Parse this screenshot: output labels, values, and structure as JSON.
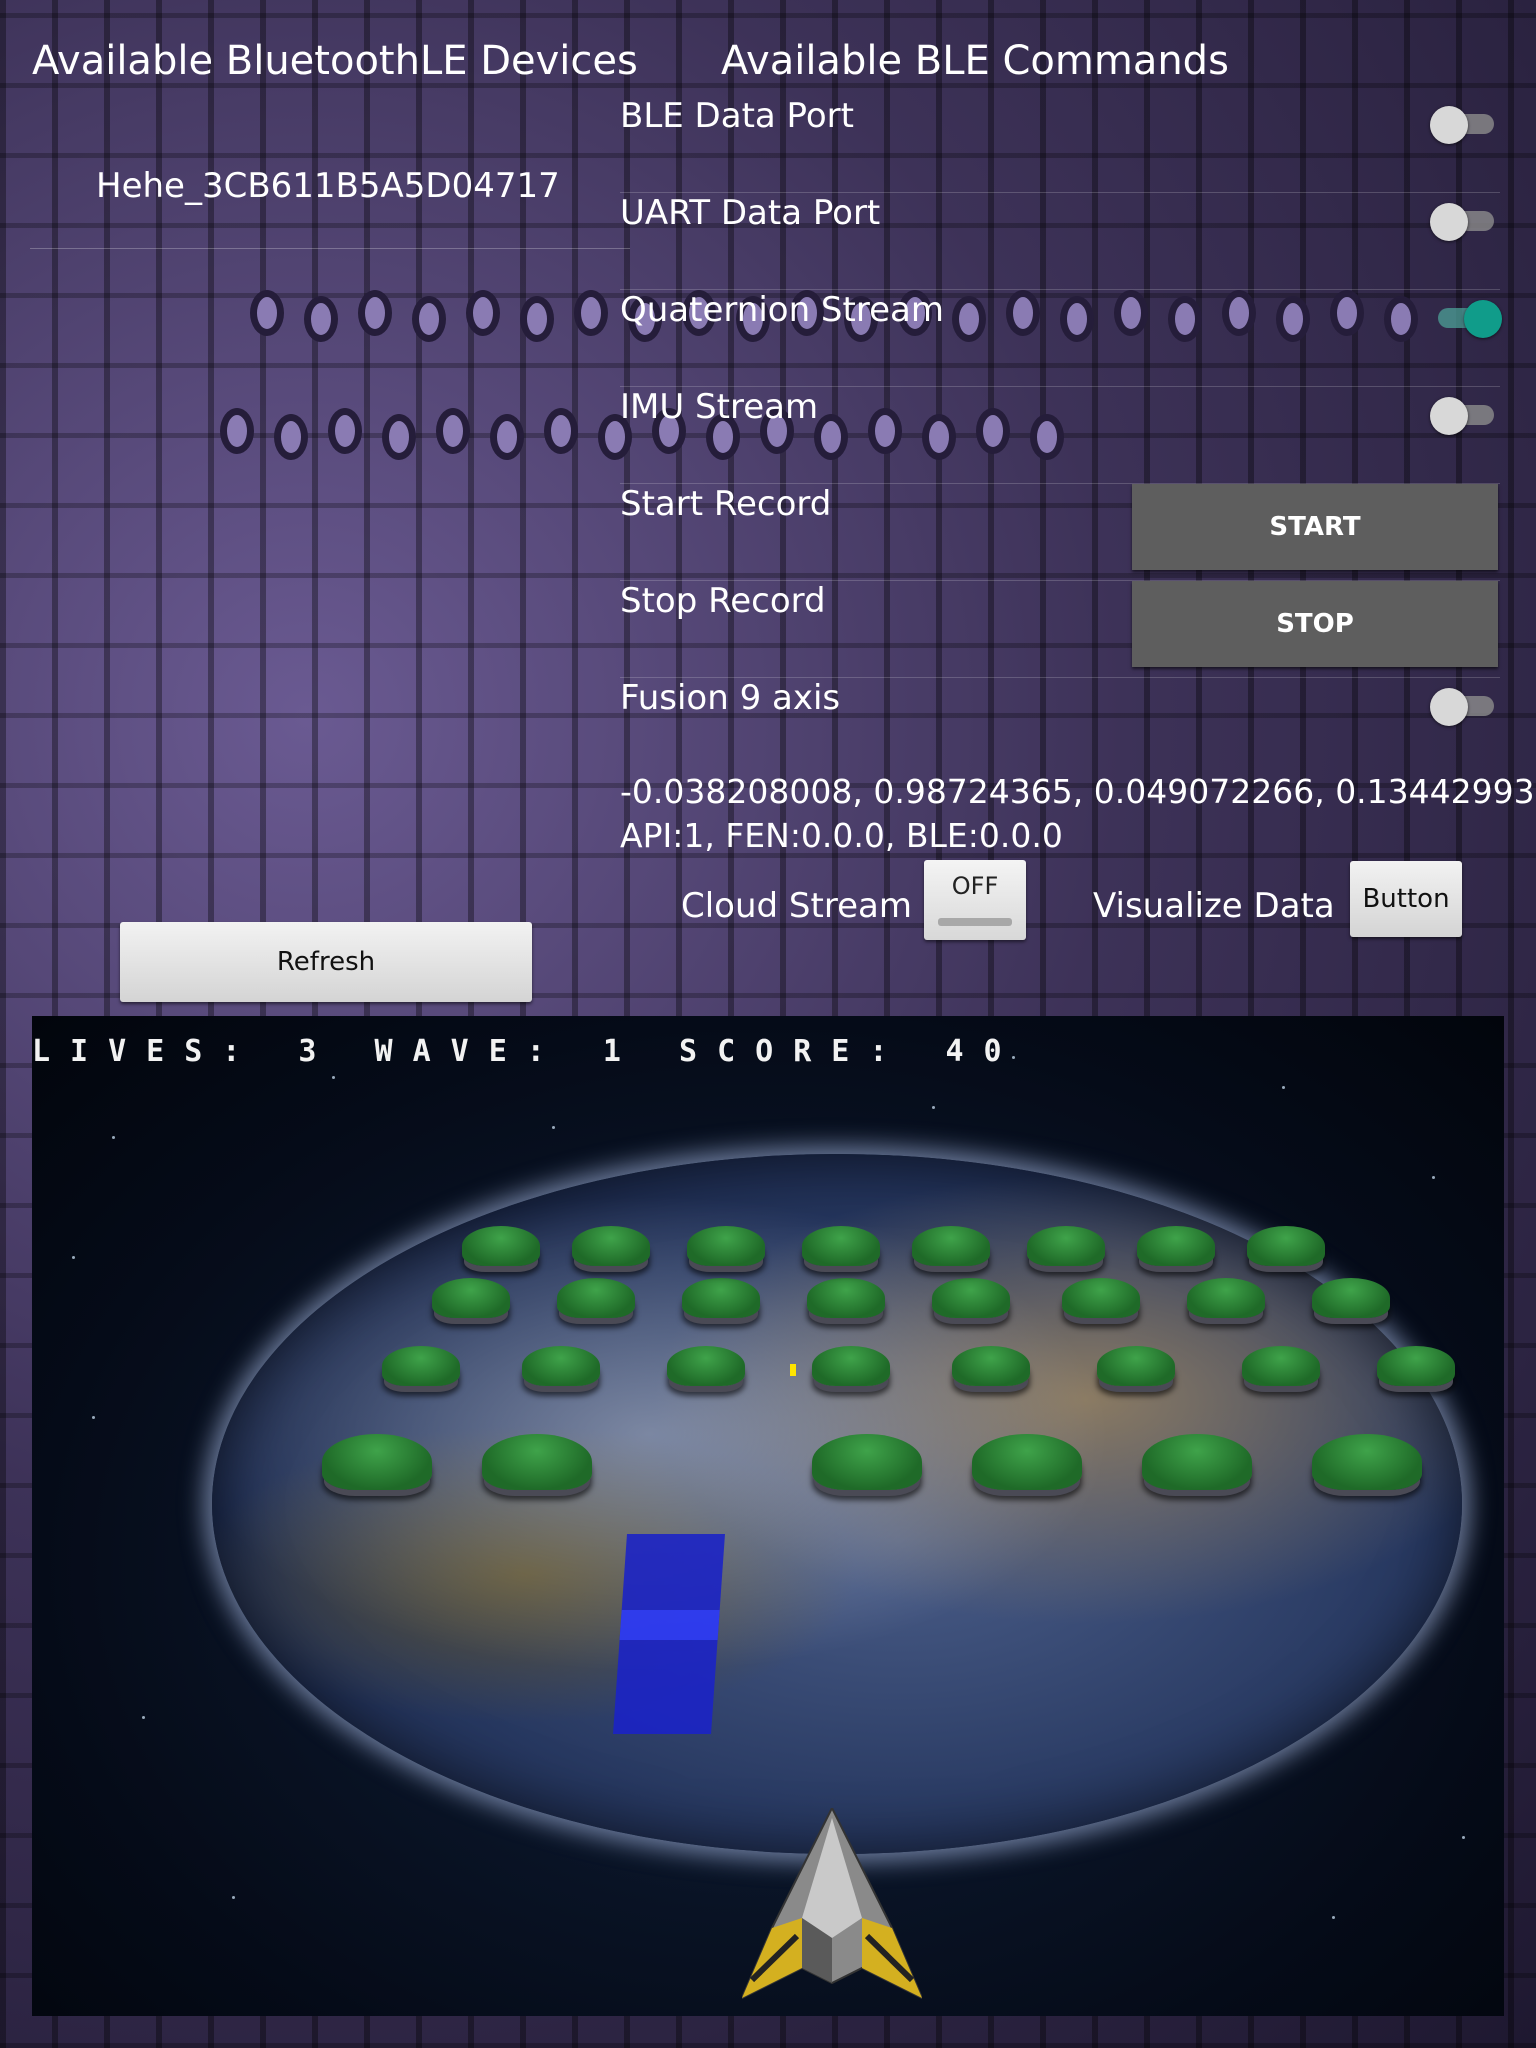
{
  "header": {
    "devices_title": "Available BluetoothLE Devices",
    "commands_title": "Available BLE Commands"
  },
  "devices": [
    "Hehe_3CB611B5A5D04717"
  ],
  "commands": [
    {
      "label": "BLE Data Port",
      "control": "switch",
      "on": false
    },
    {
      "label": "UART Data Port",
      "control": "switch",
      "on": false
    },
    {
      "label": "Quaternion Stream",
      "control": "switch",
      "on": true
    },
    {
      "label": "IMU Stream",
      "control": "switch",
      "on": false
    },
    {
      "label": "Start Record",
      "control": "button",
      "button_label": "START"
    },
    {
      "label": "Stop Record",
      "control": "button",
      "button_label": "STOP"
    },
    {
      "label": "Fusion 9 axis",
      "control": "switch",
      "on": false
    }
  ],
  "readout": {
    "quaternion": "-0.038208008,  0.98724365,  0.049072266,  0.13442993",
    "versions": "API:1, FEN:0.0.0, BLE:0.0.0"
  },
  "cloud_stream": {
    "label": "Cloud Stream",
    "toggle_text": "OFF"
  },
  "visualize": {
    "label": "Visualize Data",
    "button_label": "Button"
  },
  "refresh_label": "Refresh",
  "game": {
    "hud": "LIVES: 3 WAVE: 1 SCORE: 40",
    "colors": {
      "shield": "#1a22c8",
      "bullet": "#ffe400",
      "invader": "#2f8a3a"
    }
  },
  "colors": {
    "switch_on": "#109c8a",
    "gray_button": "#5e5e5e"
  }
}
